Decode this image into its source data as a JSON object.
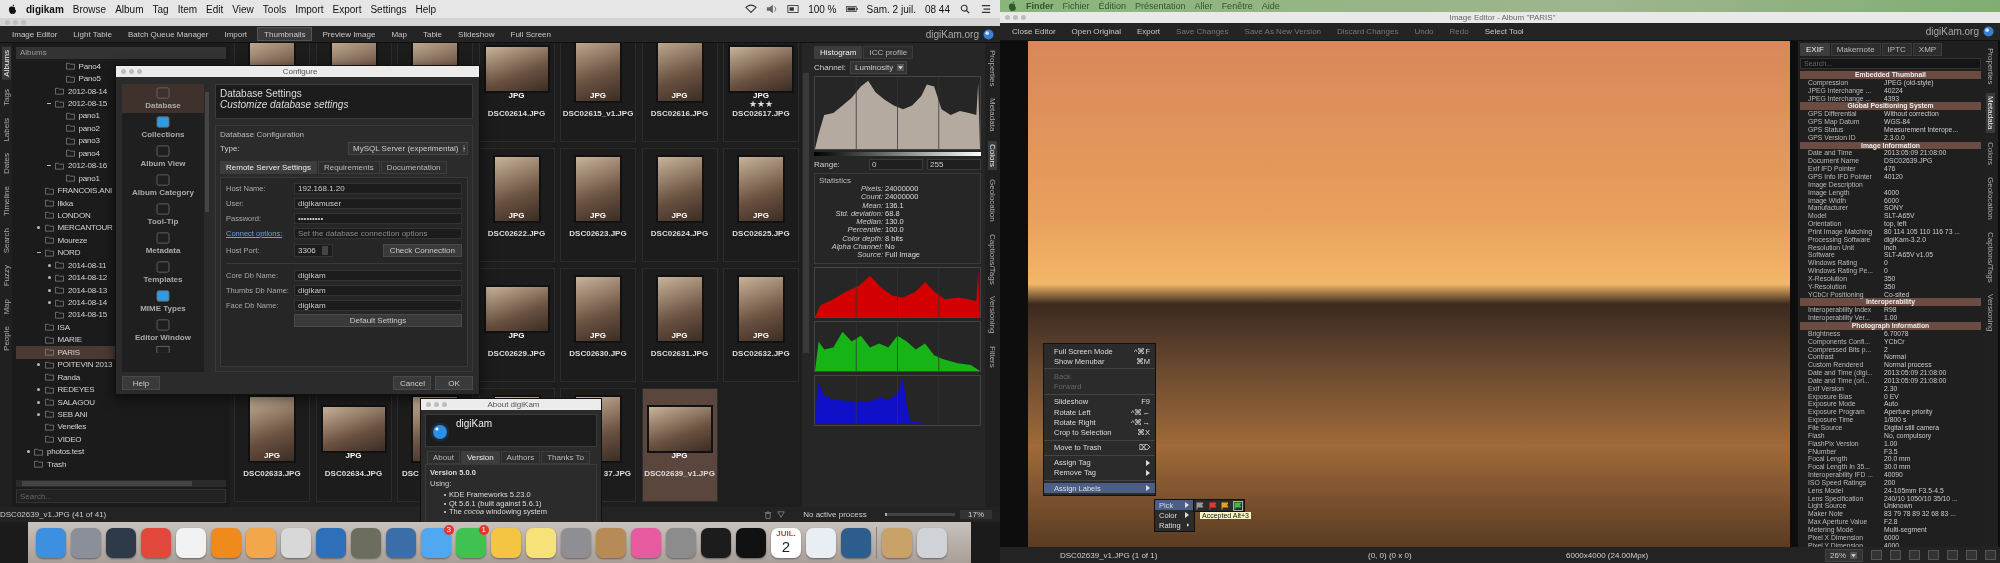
{
  "left_menubar": {
    "app": "digikam",
    "items": [
      "Browse",
      "Album",
      "Tag",
      "Item",
      "Edit",
      "View",
      "Tools",
      "Import",
      "Export",
      "Settings",
      "Help"
    ],
    "battery": "100 %",
    "date": "Sam. 2 juil.",
    "time": "08 44"
  },
  "main_toolbar": {
    "items": [
      {
        "label": "Image Editor",
        "selected": false
      },
      {
        "label": "Light Table",
        "selected": false
      },
      {
        "label": "Batch Queue Manager",
        "selected": false
      },
      {
        "label": "Import",
        "selected": false
      },
      {
        "label": "Thumbnails",
        "selected": true
      },
      {
        "label": "Preview Image",
        "selected": false
      },
      {
        "label": "Map",
        "selected": false
      },
      {
        "label": "Table",
        "selected": false
      },
      {
        "label": "Slideshow",
        "selected": false
      },
      {
        "label": "Full Screen",
        "selected": false
      }
    ],
    "site": "digiKam.org"
  },
  "left_tabs": [
    {
      "label": "Albums",
      "selected": true
    },
    {
      "label": "Tags",
      "selected": false
    },
    {
      "label": "Labels",
      "selected": false
    },
    {
      "label": "Dates",
      "selected": false
    },
    {
      "label": "Timeline",
      "selected": false
    },
    {
      "label": "Search",
      "selected": false
    },
    {
      "label": "Fuzzy",
      "selected": false
    },
    {
      "label": "Map",
      "selected": false
    },
    {
      "label": "People",
      "selected": false
    }
  ],
  "albums": {
    "title": "Albums",
    "tree": [
      {
        "children": [
          {
            "children": [
              {
                "children": [
                  {
                    "name": "Pano4",
                    "selected": false
                  },
                  {
                    "name": "Pano5",
                    "selected": false
                  }
                ]
              },
              {
                "name": "2012-08-14",
                "selected": false
              },
              {
                "name": "2012-08-15",
                "selected": false,
                "expanded": true,
                "children": [
                  {
                    "name": "pano1",
                    "selected": false
                  },
                  {
                    "name": "pano2",
                    "selected": false
                  },
                  {
                    "name": "pano3",
                    "selected": false
                  },
                  {
                    "name": "pano4",
                    "selected": false
                  }
                ]
              },
              {
                "name": "2012-08-16",
                "selected": false,
                "expanded": true,
                "children": [
                  {
                    "name": "pano1",
                    "selected": false
                  }
                ]
              }
            ]
          },
          {
            "name": "FRANCOIS.ANI",
            "selected": false
          },
          {
            "name": "Ilkka",
            "selected": false
          },
          {
            "name": "LONDON",
            "selected": false
          },
          {
            "name": "MERCANTOUR",
            "selected": false,
            "expanded": false
          },
          {
            "name": "Moureze",
            "selected": false
          },
          {
            "name": "NORD",
            "selected": false,
            "expanded": true,
            "children": [
              {
                "name": "2014-08-11",
                "selected": false,
                "expanded": false
              },
              {
                "name": "2014-08-12",
                "selected": false,
                "expanded": false
              },
              {
                "name": "2014-08-13",
                "selected": false,
                "expanded": false
              },
              {
                "name": "2014-08-14",
                "selected": false,
                "expanded": false
              },
              {
                "name": "2014-08-15",
                "selected": false
              }
            ]
          },
          {
            "name": "ISA",
            "selected": false
          },
          {
            "name": "MARIE",
            "selected": false
          },
          {
            "name": "PARIS",
            "selected": true
          },
          {
            "name": "POITEVIN 2013",
            "selected": false,
            "expanded": false
          },
          {
            "name": "Randa",
            "selected": false
          },
          {
            "name": "REDEYES",
            "selected": false,
            "expanded": false
          },
          {
            "name": "SALAGOU",
            "selected": false,
            "expanded": false
          },
          {
            "name": "SEB ANI",
            "selected": false,
            "expanded": false
          },
          {
            "name": "Venelles",
            "selected": false
          },
          {
            "name": "VIDEO",
            "selected": false
          }
        ]
      },
      {
        "name": "photos.test",
        "selected": false,
        "expanded": false
      },
      {
        "name": "Trash",
        "selected": false
      }
    ],
    "search": {
      "placeholder": "Search..."
    }
  },
  "thumbnails": {
    "rows": [
      {
        "cells": [
          "",
          "",
          "",
          {
            "selected": false,
            "name": "DSC02614.JPG",
            "badge": "JPG"
          },
          {
            "selected": false,
            "name": "DSC02615_v1.JPG",
            "badge": "JPG"
          },
          {
            "selected": false,
            "name": "DSC02616.JPG",
            "badge": "JPG"
          },
          {
            "selected": false,
            "name": "DSC02617.JPG",
            "badge": "JPG",
            "stars": 3
          }
        ]
      },
      {
        "cells": [
          "",
          "",
          "",
          {
            "selected": false,
            "name": "DSC02622.JPG",
            "badge": "JPG"
          },
          {
            "selected": false,
            "name": "DSC02623.JPG",
            "badge": "JPG"
          },
          {
            "selected": false,
            "name": "DSC02624.JPG",
            "badge": "JPG"
          },
          {
            "selected": false,
            "name": "DSC02625.JPG",
            "badge": "JPG"
          }
        ]
      },
      {
        "cells": [
          "",
          "",
          "",
          {
            "selected": false,
            "name": "DSC02629.JPG",
            "badge": "JPG"
          },
          {
            "selected": false,
            "name": "DSC02630.JPG",
            "badge": "JPG"
          },
          {
            "selected": false,
            "name": "DSC02631.JPG",
            "badge": "JPG"
          },
          {
            "selected": false,
            "name": "DSC02632.JPG",
            "badge": "JPG"
          }
        ]
      },
      {
        "cells": [
          {
            "selected": false,
            "name": "DSC02633.JPG",
            "badge": "JPG"
          },
          {
            "selected": false,
            "name": "DSC02634.JPG",
            "badge": "JPG"
          },
          {
            "selected": false,
            "name": "DSC"
          },
          "",
          {
            "selected": false,
            "name": "37.JPG"
          },
          {
            "selected": true,
            "name": "DSC02639_v1.JPG",
            "badge": "JPG"
          }
        ]
      }
    ]
  },
  "histogram": {
    "tabs": [
      {
        "label": "Histogram",
        "selected": true
      },
      {
        "label": "ICC profile",
        "selected": false
      }
    ],
    "channel_label": "Channel:",
    "channel": "Luminosity",
    "range_label": "Range:",
    "range_min": "0",
    "range_max": "255",
    "statistics_title": "Statistics",
    "statistics": [
      {
        "label": "Pixels:",
        "value": "24000000"
      },
      {
        "label": "Count:",
        "value": "24000000"
      },
      {
        "label": "Mean:",
        "value": "136.1"
      },
      {
        "label": "Std. deviation:",
        "value": "68.8"
      },
      {
        "label": "Median:",
        "value": "130.0"
      },
      {
        "label": "Percentile:",
        "value": "100.0"
      },
      {
        "label": "Color depth:",
        "value": "8 bits"
      },
      {
        "label": "Alpha Channel:",
        "value": "No"
      },
      {
        "label": "Source:",
        "value": "Full Image"
      }
    ]
  },
  "right_tabs": [
    {
      "label": "Properties",
      "selected": false
    },
    {
      "label": "Metadata",
      "selected": false
    },
    {
      "label": "Colors",
      "selected": true
    },
    {
      "label": "Geolocation",
      "selected": false
    },
    {
      "label": "Captions/Tags",
      "selected": false
    },
    {
      "label": "Versioning",
      "selected": false
    },
    {
      "label": "Filters",
      "selected": false
    }
  ],
  "status_bar": {
    "selection": "DSC02639_v1.JPG (41 of 41)",
    "process": "No active process",
    "zoom": "17%",
    "level": 0.03
  },
  "configure_dialog": {
    "title": "Configure",
    "pages": [
      {
        "label": "Database",
        "selected": true
      },
      {
        "label": "Collections",
        "selected": false
      },
      {
        "label": "Album View",
        "selected": false
      },
      {
        "label": "Album Category",
        "selected": false
      },
      {
        "label": "Tool-Tip",
        "selected": false
      },
      {
        "label": "Metadata",
        "selected": false
      },
      {
        "label": "Templates",
        "selected": false
      },
      {
        "label": "MIME Types",
        "selected": false
      },
      {
        "label": "Editor Window",
        "selected": false
      }
    ],
    "heading": "Database Settings",
    "subheading": "Customize database settings",
    "group": "Database Configuration",
    "type_label": "Type:",
    "type_value": "MySQL Server (experimental)",
    "tabs": [
      {
        "label": "Remote Server Settings",
        "selected": true
      },
      {
        "label": "Requirements",
        "selected": false
      },
      {
        "label": "Documentation",
        "selected": false
      }
    ],
    "fields": [
      {
        "label": "Host Name:",
        "value": "192.168.1.20"
      },
      {
        "label": "User:",
        "value": "digikamuser"
      },
      {
        "label": "Password:",
        "value": "•••••••••"
      }
    ],
    "connect_link": "Connect options:",
    "connect_placeholder": "Set the database connection options",
    "port_label": "Host Port:",
    "port_value": "3306",
    "check_button": "Check Connection",
    "db_fields": [
      {
        "label": "Core Db Name:",
        "value": "digikam"
      },
      {
        "label": "Thumbs Db Name:",
        "value": "digikam"
      },
      {
        "label": "Face Db Name:",
        "value": "digikam"
      }
    ],
    "default_button": "Default Settings",
    "help_button": "Help",
    "cancel_button": "Cancel",
    "ok_button": "OK"
  },
  "about_dialog": {
    "title": "About digiKam",
    "app": "digiKam",
    "tabs": [
      {
        "label": "About",
        "selected": false
      },
      {
        "label": "Version",
        "selected": true
      },
      {
        "label": "Authors",
        "selected": false
      },
      {
        "label": "Thanks To",
        "selected": false
      }
    ],
    "version": "Version 5.0.0",
    "using": "Using:",
    "bullets": [
      "KDE Frameworks 5.23.0",
      "Qt 5.6.1 (built against 5.6.1)",
      "The *cocoa* windowing system"
    ]
  },
  "dock": [
    {
      "kind": "icon"
    },
    {
      "kind": "icon"
    },
    {
      "kind": "icon"
    },
    {
      "kind": "icon"
    },
    {
      "kind": "icon"
    },
    {
      "kind": "icon"
    },
    {
      "kind": "icon"
    },
    {
      "kind": "icon"
    },
    {
      "kind": "icon"
    },
    {
      "kind": "icon"
    },
    {
      "kind": "icon"
    },
    {
      "kind": "icon",
      "badge": "3"
    },
    {
      "kind": "icon",
      "badge": "1"
    },
    {
      "kind": "icon"
    },
    {
      "kind": "icon"
    },
    {
      "kind": "icon"
    },
    {
      "kind": "icon"
    },
    {
      "kind": "icon"
    },
    {
      "kind": "icon"
    },
    {
      "kind": "icon"
    },
    {
      "kind": "icon"
    },
    {
      "kind": "calendar",
      "month": "JUIL.",
      "day": "2"
    },
    {
      "kind": "icon"
    },
    {
      "kind": "icon"
    },
    {
      "kind": "separator"
    },
    {
      "kind": "icon"
    },
    {
      "kind": "icon"
    }
  ],
  "right_menubar": {
    "app": "Finder",
    "items": [
      "Fichier",
      "Édition",
      "Présentation",
      "Aller",
      "Fenêtre",
      "Aide"
    ]
  },
  "image_editor": {
    "title": "Image Editor - Album \"PARIS\"",
    "site": "digiKam.org",
    "toolbar": [
      {
        "label": "Close Editor",
        "disabled": false
      },
      {
        "label": "Open Original",
        "disabled": false
      },
      {
        "label": "Export",
        "disabled": false
      },
      {
        "label": "Save Changes",
        "disabled": true
      },
      {
        "label": "Save As New Version",
        "disabled": true
      },
      {
        "label": "Discard Changes",
        "disabled": true
      },
      {
        "label": "Undo",
        "disabled": true
      },
      {
        "label": "Redo",
        "disabled": true
      },
      {
        "label": "Select Tool",
        "disabled": false
      }
    ],
    "context_menu": [
      {
        "kind": "item",
        "label": "Full Screen Mode",
        "shortcut": "^⌘F",
        "disabled": false,
        "selected": false
      },
      {
        "kind": "item",
        "label": "Show Menubar",
        "shortcut": "⌘M",
        "disabled": false,
        "selected": false
      },
      {
        "kind": "separator"
      },
      {
        "kind": "item",
        "label": "Back",
        "disabled": true,
        "selected": false
      },
      {
        "kind": "item",
        "label": "Forward",
        "disabled": true,
        "selected": false
      },
      {
        "kind": "separator"
      },
      {
        "kind": "item",
        "label": "Slideshow",
        "shortcut": "F9",
        "disabled": false,
        "selected": false
      },
      {
        "kind": "item",
        "label": "Rotate Left",
        "shortcut": "^⌘←",
        "disabled": false,
        "selected": false
      },
      {
        "kind": "item",
        "label": "Rotate Right",
        "shortcut": "^⌘→",
        "disabled": false,
        "selected": false
      },
      {
        "kind": "item",
        "label": "Crop to Selection",
        "shortcut": "⌘X",
        "disabled": false,
        "selected": false
      },
      {
        "kind": "separator"
      },
      {
        "kind": "item",
        "label": "Move to Trash",
        "shortcut": "⌦",
        "disabled": false,
        "selected": false
      },
      {
        "kind": "separator"
      },
      {
        "kind": "submenu",
        "label": "Assign Tag",
        "disabled": false,
        "selected": false
      },
      {
        "kind": "submenu",
        "label": "Remove Tag",
        "disabled": false,
        "selected": false
      },
      {
        "kind": "separator"
      },
      {
        "kind": "submenu",
        "label": "Assign Labels",
        "disabled": false,
        "selected": true
      }
    ],
    "labels_submenu": [
      {
        "label": "Pick",
        "selected": true
      },
      {
        "label": "Color",
        "selected": false
      },
      {
        "label": "Rating",
        "selected": false
      }
    ],
    "pick_flags": [
      {
        "color": "#9a9a9a",
        "selected": false
      },
      {
        "color": "#e23b2e",
        "selected": false
      },
      {
        "color": "#e7a21f",
        "selected": false
      },
      {
        "color": "#3cbf3c",
        "selected": true
      }
    ],
    "tooltip": "Accepted Alt+3",
    "metadata": {
      "tabs": [
        {
          "label": "EXIF",
          "selected": true
        },
        {
          "label": "Makernote",
          "selected": false
        },
        {
          "label": "IPTC",
          "selected": false
        },
        {
          "label": "XMP",
          "selected": false
        }
      ],
      "search": {
        "placeholder": "Search..."
      },
      "sections": [
        {
          "title": "Embedded Thumbnail",
          "rows": [
            [
              "Compression",
              "JPEG (old-style)"
            ],
            [
              "JPEG Interchange ...",
              "40224"
            ],
            [
              "JPEG Interchange ...",
              "4393"
            ]
          ]
        },
        {
          "title": "Global Positioning System",
          "rows": [
            [
              "GPS Differential",
              "Without correction"
            ],
            [
              "GPS Map Datum",
              "WGS-84"
            ],
            [
              "GPS Status",
              "Measurement Interope..."
            ],
            [
              "GPS Version ID",
              "2.3.0.0"
            ]
          ]
        },
        {
          "title": "Image Information",
          "rows": [
            [
              "Date and Time",
              "2013:05:09 21:08:00"
            ],
            [
              "Document Name",
              "DSC02639.JPG"
            ],
            [
              "Exif IFD Pointer",
              "476"
            ],
            [
              "GPS Info IFD Pointer",
              "40120"
            ],
            [
              "Image Description"
            ],
            [
              "Image Length",
              "4000"
            ],
            [
              "Image Width",
              "6000"
            ],
            [
              "Manufacturer",
              "SONY"
            ],
            [
              "Model",
              "SLT-A65V"
            ],
            [
              "Orientation",
              "top, left"
            ],
            [
              "Print Image Matching",
              "80 114 105 110 116 73 ..."
            ],
            [
              "Processing Software",
              "digiKam-3.2.0"
            ],
            [
              "Resolution Unit",
              "inch"
            ],
            [
              "Software",
              "SLT-A65V v1.05"
            ],
            [
              "Windows Rating",
              "0"
            ],
            [
              "Windows Rating Pe...",
              "0"
            ],
            [
              "X-Resolution",
              "350"
            ],
            [
              "Y-Resolution",
              "350"
            ],
            [
              "YCbCr Positioning",
              "Co-sited"
            ]
          ]
        },
        {
          "title": "Interoperability",
          "rows": [
            [
              "Interoperability Index",
              "R98"
            ],
            [
              "Interoperability Ver...",
              "1.00"
            ]
          ]
        },
        {
          "title": "Photograph Information",
          "rows": [
            [
              "Brightness",
              "6.70078"
            ],
            [
              "Components Confi...",
              "YCbCr"
            ],
            [
              "Compressed Bits p...",
              "2"
            ],
            [
              "Contrast",
              "Normal"
            ],
            [
              "Custom Rendered",
              "Normal process"
            ],
            [
              "Date and Time (digi...",
              "2013:05:09 21:08:00"
            ],
            [
              "Date and Time (ori...",
              "2013:05:09 21:08:00"
            ],
            [
              "Exif Version",
              "2.30"
            ],
            [
              "Exposure Bias",
              "0 EV"
            ],
            [
              "Exposure Mode",
              "Auto"
            ],
            [
              "Exposure Program",
              "Aperture priority"
            ],
            [
              "Exposure Time",
              "1/800 s"
            ],
            [
              "File Source",
              "Digital still camera"
            ],
            [
              "Flash",
              "No, compulsory"
            ],
            [
              "FlashPix Version",
              "1.00"
            ],
            [
              "FNumber",
              "F3.5"
            ],
            [
              "Focal Length",
              "20.0 mm"
            ],
            [
              "Focal Length In 35...",
              "30.0 mm"
            ],
            [
              "Interoperability IFD ...",
              "40090"
            ],
            [
              "ISO Speed Ratings",
              "200"
            ],
            [
              "Lens Model",
              "24-105mm F3.5-4.5"
            ],
            [
              "Lens Specification",
              "240/10 1050/10 35/10 ..."
            ],
            [
              "Light Source",
              "Unknown"
            ],
            [
              "Maker Note",
              "83 79 78 89 32 68 83 ..."
            ],
            [
              "Max Aperture Value",
              "F2.8"
            ],
            [
              "Metering Mode",
              "Multi-segment"
            ],
            [
              "Pixel X Dimension",
              "6000"
            ],
            [
              "Pixel Y Dimension",
              "4000"
            ]
          ]
        }
      ]
    },
    "side_tabs": [
      {
        "label": "Properties",
        "selected": false
      },
      {
        "label": "Metadata",
        "selected": true
      },
      {
        "label": "Colors",
        "selected": false
      },
      {
        "label": "Geolocation",
        "selected": false
      },
      {
        "label": "Captions/Tags",
        "selected": false
      },
      {
        "label": "Versioning",
        "selected": false
      }
    ],
    "status_bar": {
      "file": "DSC02639_v1.JPG (1 of 1)",
      "position": "(0, 0) (0 x 0)",
      "size": "6000x4000 (24.00Mpx)",
      "zoom": "26%"
    }
  }
}
